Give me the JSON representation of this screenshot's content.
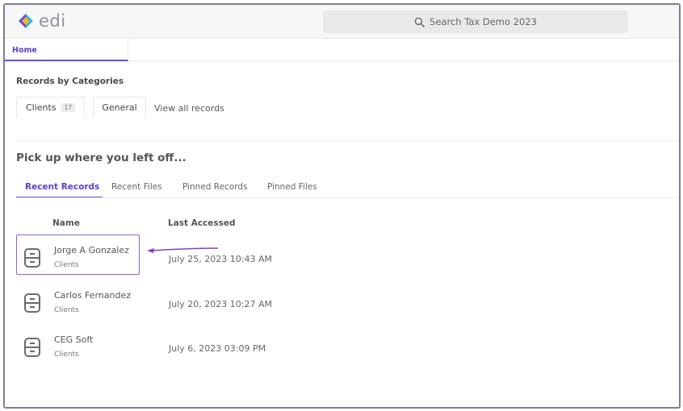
{
  "app": {
    "logo_text": "edi"
  },
  "search": {
    "placeholder": "Search Tax Demo 2023"
  },
  "tabs": {
    "home": "Home"
  },
  "categories": {
    "title": "Records by Categories",
    "clients_label": "Clients",
    "clients_count": "17",
    "general_label": "General",
    "view_all": "View all records"
  },
  "recent": {
    "title": "Pick up where you left off...",
    "tabs": [
      "Recent Records",
      "Recent Files",
      "Pinned Records",
      "Pinned Files"
    ],
    "columns": {
      "name": "Name",
      "last_accessed": "Last Accessed"
    },
    "rows": [
      {
        "name": "Jorge A Gonzalez",
        "category": "Clients",
        "accessed": "July 25, 2023 10:43 AM",
        "icon": "cabinet-icon"
      },
      {
        "name": "Carlos Fernandez",
        "category": "Clients",
        "accessed": "July 20, 2023 10:27 AM",
        "icon": "cabinet-icon"
      },
      {
        "name": "CEG Soft",
        "category": "Clients",
        "accessed": "July 6, 2023 03:09 PM",
        "icon": "cabinet-icon"
      }
    ]
  },
  "colors": {
    "accent": "#5b3fd0",
    "highlight": "#8e5fd7",
    "frame": "#7c7f97"
  }
}
